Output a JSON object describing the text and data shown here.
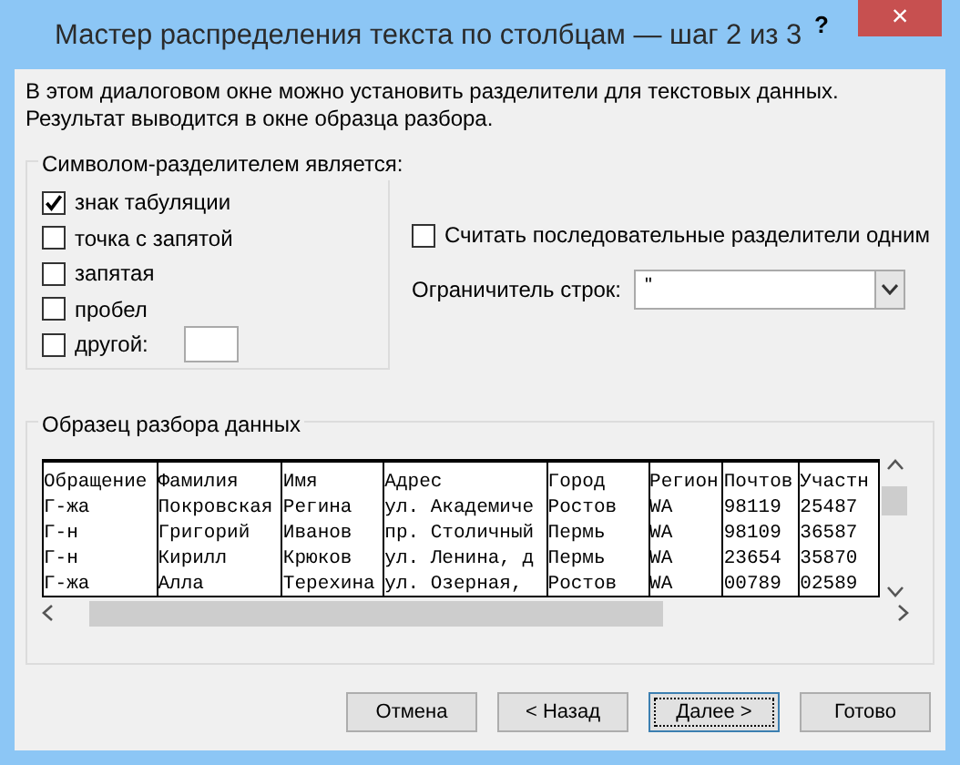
{
  "window": {
    "title": "Мастер распределения текста по столбцам — шаг 2 из 3",
    "help": "?",
    "close": "×"
  },
  "intro": "В этом диалоговом окне можно установить разделители для текстовых данных. Результат выводится в окне образца разбора.",
  "delimiters": {
    "title": "Символом-разделителем является:",
    "items": [
      {
        "label": "знак табуляции",
        "checked": true
      },
      {
        "label": "точка с запятой",
        "checked": false
      },
      {
        "label": "запятая",
        "checked": false
      },
      {
        "label": "пробел",
        "checked": false
      },
      {
        "label": "другой:",
        "checked": false,
        "kind": "other"
      }
    ]
  },
  "consecutive": {
    "label": "Считать последовательные разделители одним",
    "checked": false
  },
  "qualifier": {
    "label": "Ограничитель строк:",
    "value": "\""
  },
  "preview": {
    "title": "Образец разбора данных",
    "rows": [
      [
        "Обращение",
        "Фамилия",
        "Имя",
        "Адрес",
        "Город",
        "Регион",
        "Почтов",
        "Участн"
      ],
      [
        "Г-жа",
        "Покровская",
        "Регина",
        "ул. Академиче",
        "Ростов",
        "WA",
        "98119",
        "25487"
      ],
      [
        "Г-н",
        "Григорий",
        "Иванов",
        "пр. Столичный",
        "Пермь",
        "WA",
        "98109",
        "36587"
      ],
      [
        "Г-н",
        "Кирилл",
        "Крюков",
        "ул. Ленина, д",
        "Пермь",
        "WA",
        "23654",
        "35870"
      ],
      [
        "Г-жа",
        "Алла",
        "Терехина",
        "ул. Озерная,",
        "Ростов",
        "WA",
        "00789",
        "02589"
      ]
    ]
  },
  "buttons": [
    {
      "label": "Отмена",
      "selected": false
    },
    {
      "label": "< Назад",
      "selected": false
    },
    {
      "label": "Далее >",
      "selected": true
    },
    {
      "label": "Готово",
      "selected": false
    }
  ]
}
